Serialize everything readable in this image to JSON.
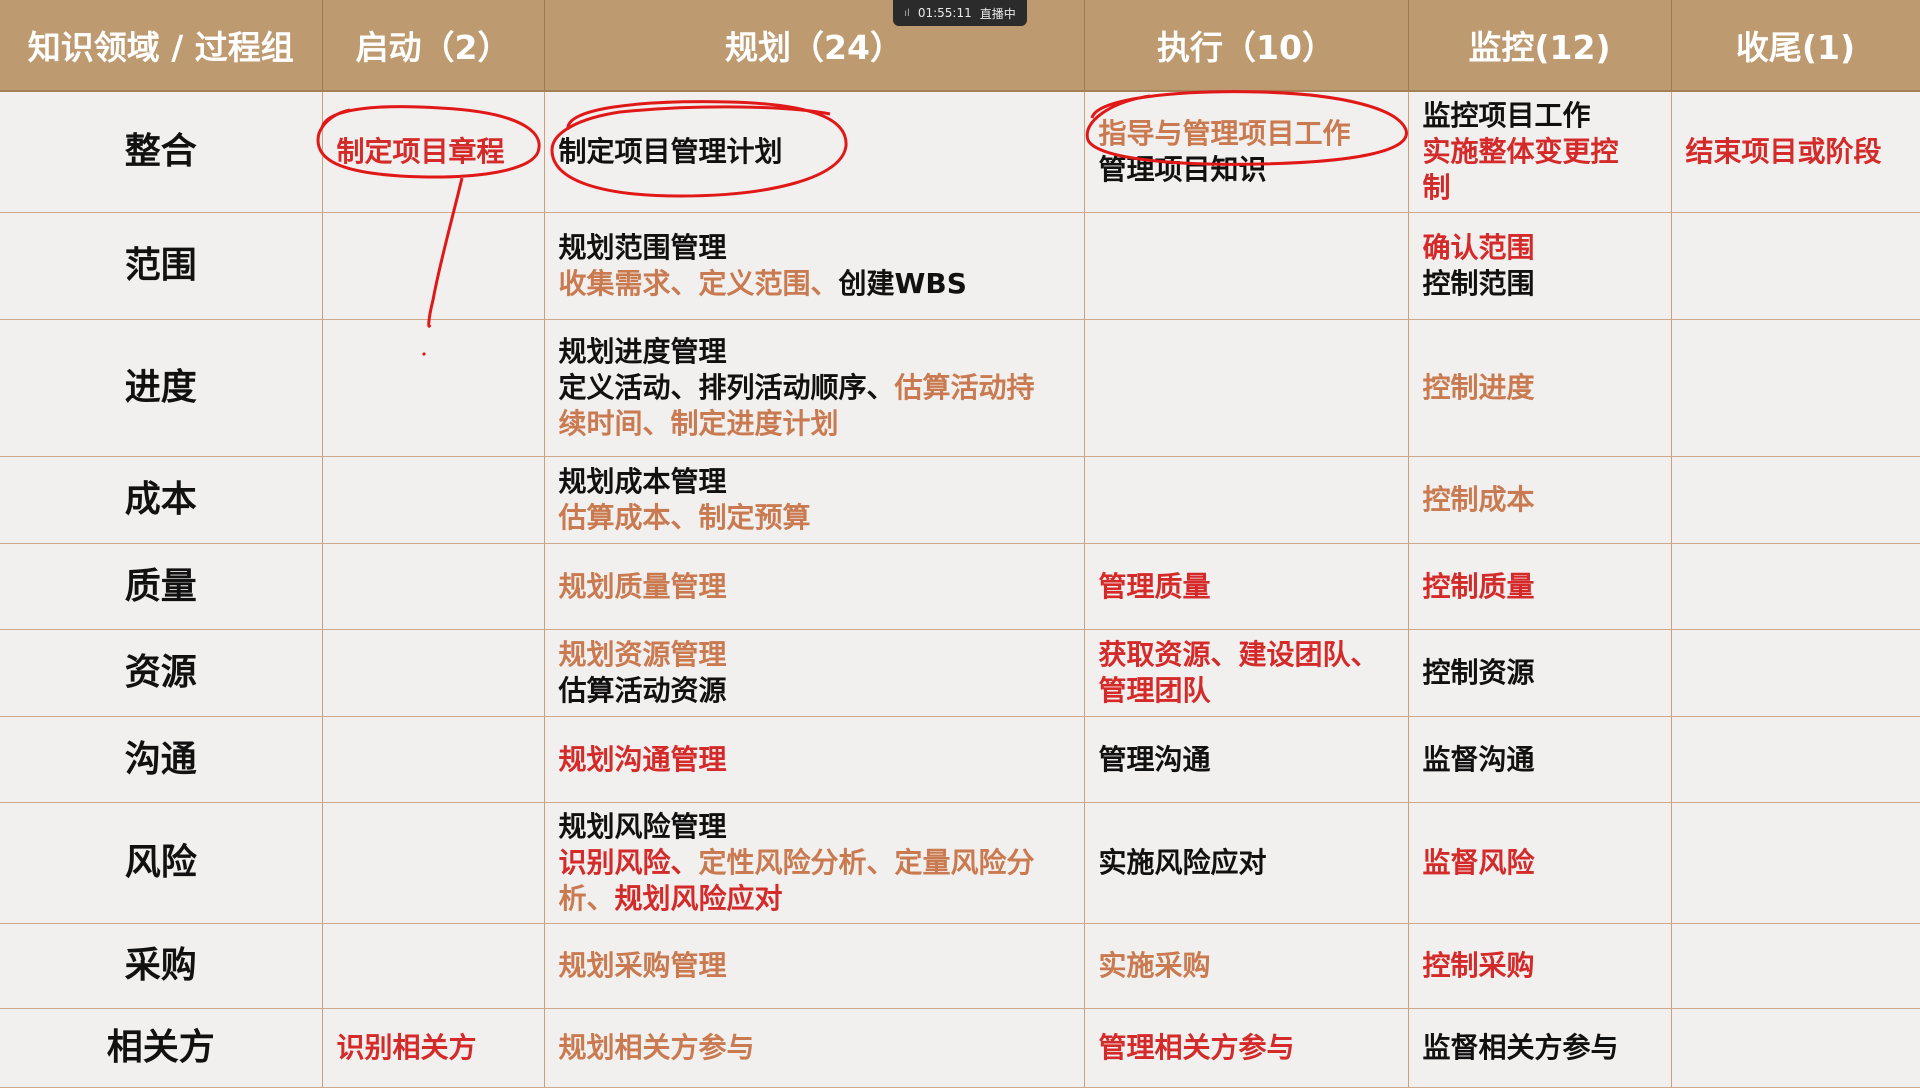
{
  "live": {
    "time": "01:55:11",
    "status": "直播中",
    "signal_glyph": "ıl"
  },
  "colors": {
    "header_bg": "#be9a70",
    "red": "#d42a2a",
    "orange": "#c97a50",
    "black": "#111111",
    "ink": "#e01818"
  },
  "headers": [
    "知识领域 / 过程组",
    "启动（2）",
    "规划（24）",
    "执行（10）",
    "监控(12)",
    "收尾(1)"
  ],
  "rows": [
    {
      "area": "整合",
      "cells": [
        [
          [
            {
              "t": "制定项目章程",
              "c": "r"
            }
          ]
        ],
        [
          [
            {
              "t": "制定项目管理计划",
              "c": "k"
            }
          ]
        ],
        [
          [
            {
              "t": "指导与管理项目工作",
              "c": "o"
            }
          ],
          [
            {
              "t": "管理项目知识",
              "c": "k"
            }
          ]
        ],
        [
          [
            {
              "t": "监控项目工作",
              "c": "k"
            }
          ],
          [
            {
              "t": "实施整体变更控",
              "c": "r"
            }
          ],
          [
            {
              "t": "制",
              "c": "r"
            }
          ]
        ],
        [
          [
            {
              "t": "结束项目或阶段",
              "c": "r"
            }
          ]
        ]
      ]
    },
    {
      "area": "范围",
      "cells": [
        [],
        [
          [
            {
              "t": "规划范围管理",
              "c": "k"
            }
          ],
          [
            {
              "t": "收集需求、定义范围、",
              "c": "o"
            },
            {
              "t": "创建WBS",
              "c": "k"
            }
          ]
        ],
        [],
        [
          [
            {
              "t": "确认范围",
              "c": "r"
            }
          ],
          [
            {
              "t": "控制范围",
              "c": "k"
            }
          ]
        ],
        []
      ]
    },
    {
      "area": "进度",
      "cells": [
        [],
        [
          [
            {
              "t": "规划进度管理",
              "c": "k"
            }
          ],
          [
            {
              "t": "定义活动、排列活动顺序、",
              "c": "k"
            },
            {
              "t": "估算活动持",
              "c": "o"
            }
          ],
          [
            {
              "t": "续时间、制定进度计划",
              "c": "o"
            }
          ]
        ],
        [],
        [
          [
            {
              "t": "控制进度",
              "c": "o"
            }
          ]
        ],
        []
      ]
    },
    {
      "area": "成本",
      "cells": [
        [],
        [
          [
            {
              "t": "规划成本管理",
              "c": "k"
            }
          ],
          [
            {
              "t": "估算成本、制定预算",
              "c": "o"
            }
          ]
        ],
        [],
        [
          [
            {
              "t": "控制成本",
              "c": "o"
            }
          ]
        ],
        []
      ]
    },
    {
      "area": "质量",
      "cells": [
        [],
        [
          [
            {
              "t": "规划质量管理",
              "c": "o"
            }
          ]
        ],
        [
          [
            {
              "t": "管理质量",
              "c": "r"
            }
          ]
        ],
        [
          [
            {
              "t": "控制质量",
              "c": "r"
            }
          ]
        ],
        []
      ]
    },
    {
      "area": "资源",
      "cells": [
        [],
        [
          [
            {
              "t": "规划资源管理",
              "c": "o"
            }
          ],
          [
            {
              "t": "估算活动资源",
              "c": "k"
            }
          ]
        ],
        [
          [
            {
              "t": "获取资源、建设团队、",
              "c": "r"
            }
          ],
          [
            {
              "t": "管理团队",
              "c": "r"
            }
          ]
        ],
        [
          [
            {
              "t": "控制资源",
              "c": "k"
            }
          ]
        ],
        []
      ]
    },
    {
      "area": "沟通",
      "cells": [
        [],
        [
          [
            {
              "t": "规划沟通管理",
              "c": "r"
            }
          ]
        ],
        [
          [
            {
              "t": "管理沟通",
              "c": "k"
            }
          ]
        ],
        [
          [
            {
              "t": "监督沟通",
              "c": "k"
            }
          ]
        ],
        []
      ]
    },
    {
      "area": "风险",
      "cells": [
        [],
        [
          [
            {
              "t": "规划风险管理",
              "c": "k"
            }
          ],
          [
            {
              "t": "识别风险、",
              "c": "r"
            },
            {
              "t": "定性风险分析、定量风险分",
              "c": "o"
            }
          ],
          [
            {
              "t": "析、",
              "c": "o"
            },
            {
              "t": "规划风险应对",
              "c": "r"
            }
          ]
        ],
        [
          [
            {
              "t": "实施风险应对",
              "c": "k"
            }
          ]
        ],
        [
          [
            {
              "t": "监督风险",
              "c": "r"
            }
          ]
        ],
        []
      ]
    },
    {
      "area": "采购",
      "cells": [
        [],
        [
          [
            {
              "t": "规划采购管理",
              "c": "o"
            }
          ]
        ],
        [
          [
            {
              "t": "实施采购",
              "c": "o"
            }
          ]
        ],
        [
          [
            {
              "t": "控制采购",
              "c": "r"
            }
          ]
        ],
        []
      ]
    },
    {
      "area": "相关方",
      "cells": [
        [
          [
            {
              "t": "识别相关方",
              "c": "r"
            }
          ]
        ],
        [
          [
            {
              "t": "规划相关方参与",
              "c": "o"
            }
          ]
        ],
        [
          [
            {
              "t": "管理相关方参与",
              "c": "r"
            }
          ]
        ],
        [
          [
            {
              "t": "监督相关方参与",
              "c": "k"
            }
          ]
        ],
        []
      ]
    }
  ]
}
